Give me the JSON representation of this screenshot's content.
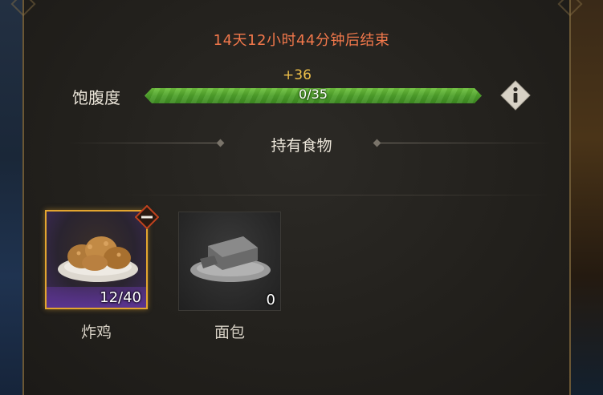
{
  "event": {
    "timer_text": "14天12小时44分钟后结束"
  },
  "satiety": {
    "label": "饱腹度",
    "bonus": "+36",
    "progress_text": "0/35",
    "current": 0,
    "max": 35,
    "info_icon": "info-icon"
  },
  "section": {
    "title": "持有食物"
  },
  "foods": [
    {
      "name": "炸鸡",
      "quantity": "12/40",
      "selected": true,
      "icon": "fried-chicken-icon",
      "badge_icon": "minus-icon"
    },
    {
      "name": "面包",
      "quantity": "0",
      "selected": false,
      "icon": "bread-icon"
    }
  ],
  "colors": {
    "timer": "#f2784b",
    "bonus": "#f0c14a",
    "bar_fill": "#4ea12b",
    "selected_border": "#e3a52f",
    "selected_bg": "#5a3490"
  }
}
